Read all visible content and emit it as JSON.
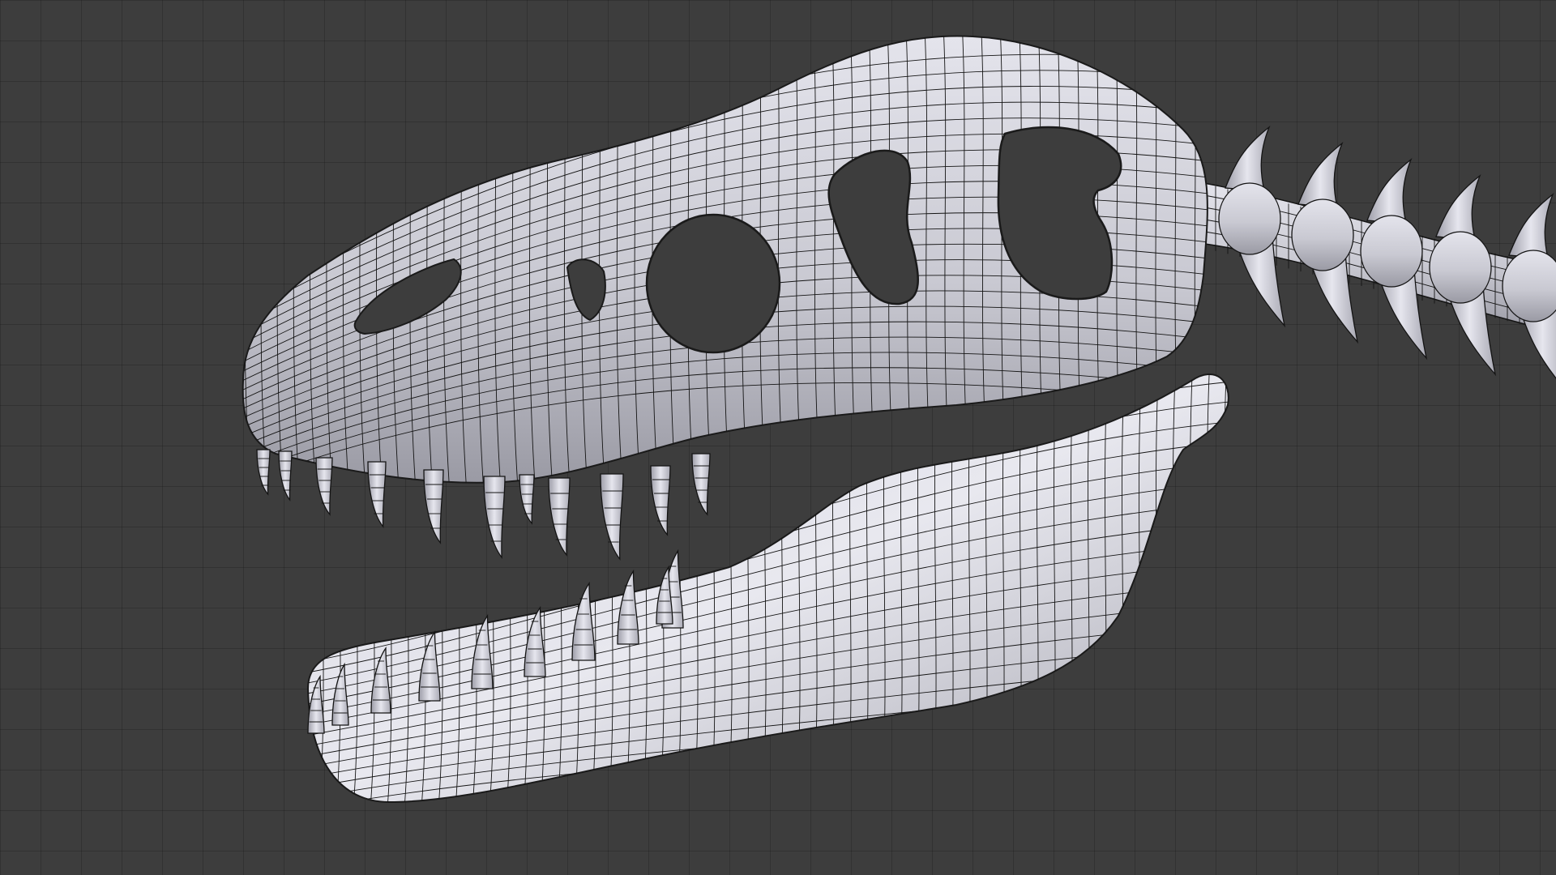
{
  "viewport": {
    "type": "3d-viewport",
    "background_color": "#3d3d3d",
    "grid_color": "#323232",
    "mesh_color": "#c8c8d0",
    "wire_color": "#141414"
  },
  "scene": {
    "objects": [
      {
        "name": "skull-upper",
        "shading": "solid-wireframe"
      },
      {
        "name": "lower-jaw",
        "shading": "solid-wireframe"
      },
      {
        "name": "upper-teeth",
        "count": 11
      },
      {
        "name": "lower-teeth",
        "count": 10
      },
      {
        "name": "vertebrae",
        "count": 5
      }
    ]
  }
}
